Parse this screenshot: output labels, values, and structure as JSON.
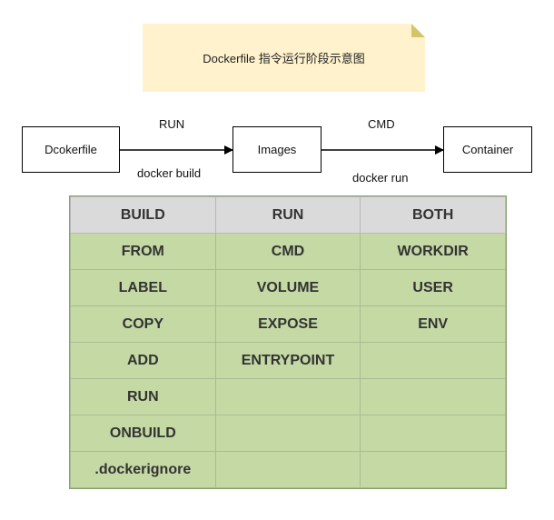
{
  "note": {
    "text": "Dockerfile 指令运行阶段示意图"
  },
  "flow": {
    "nodes": [
      "Dcokerfile",
      "Images",
      "Container"
    ],
    "edges": [
      {
        "top_label": "RUN",
        "bottom_label": "docker build"
      },
      {
        "top_label": "CMD",
        "bottom_label": "docker run"
      }
    ]
  },
  "table": {
    "headers": [
      "BUILD",
      "RUN",
      "BOTH"
    ],
    "rows": [
      [
        "FROM",
        "CMD",
        "WORKDIR"
      ],
      [
        "LABEL",
        "VOLUME",
        "USER"
      ],
      [
        "COPY",
        "EXPOSE",
        "ENV"
      ],
      [
        "ADD",
        "ENTRYPOINT",
        ""
      ],
      [
        "RUN",
        "",
        ""
      ],
      [
        "ONBUILD",
        "",
        ""
      ],
      [
        ".dockerignore",
        "",
        ""
      ]
    ]
  },
  "colors": {
    "note_bg": "#fff2cc",
    "header_bg": "#dadada",
    "cell_bg": "#c5d9a4"
  }
}
